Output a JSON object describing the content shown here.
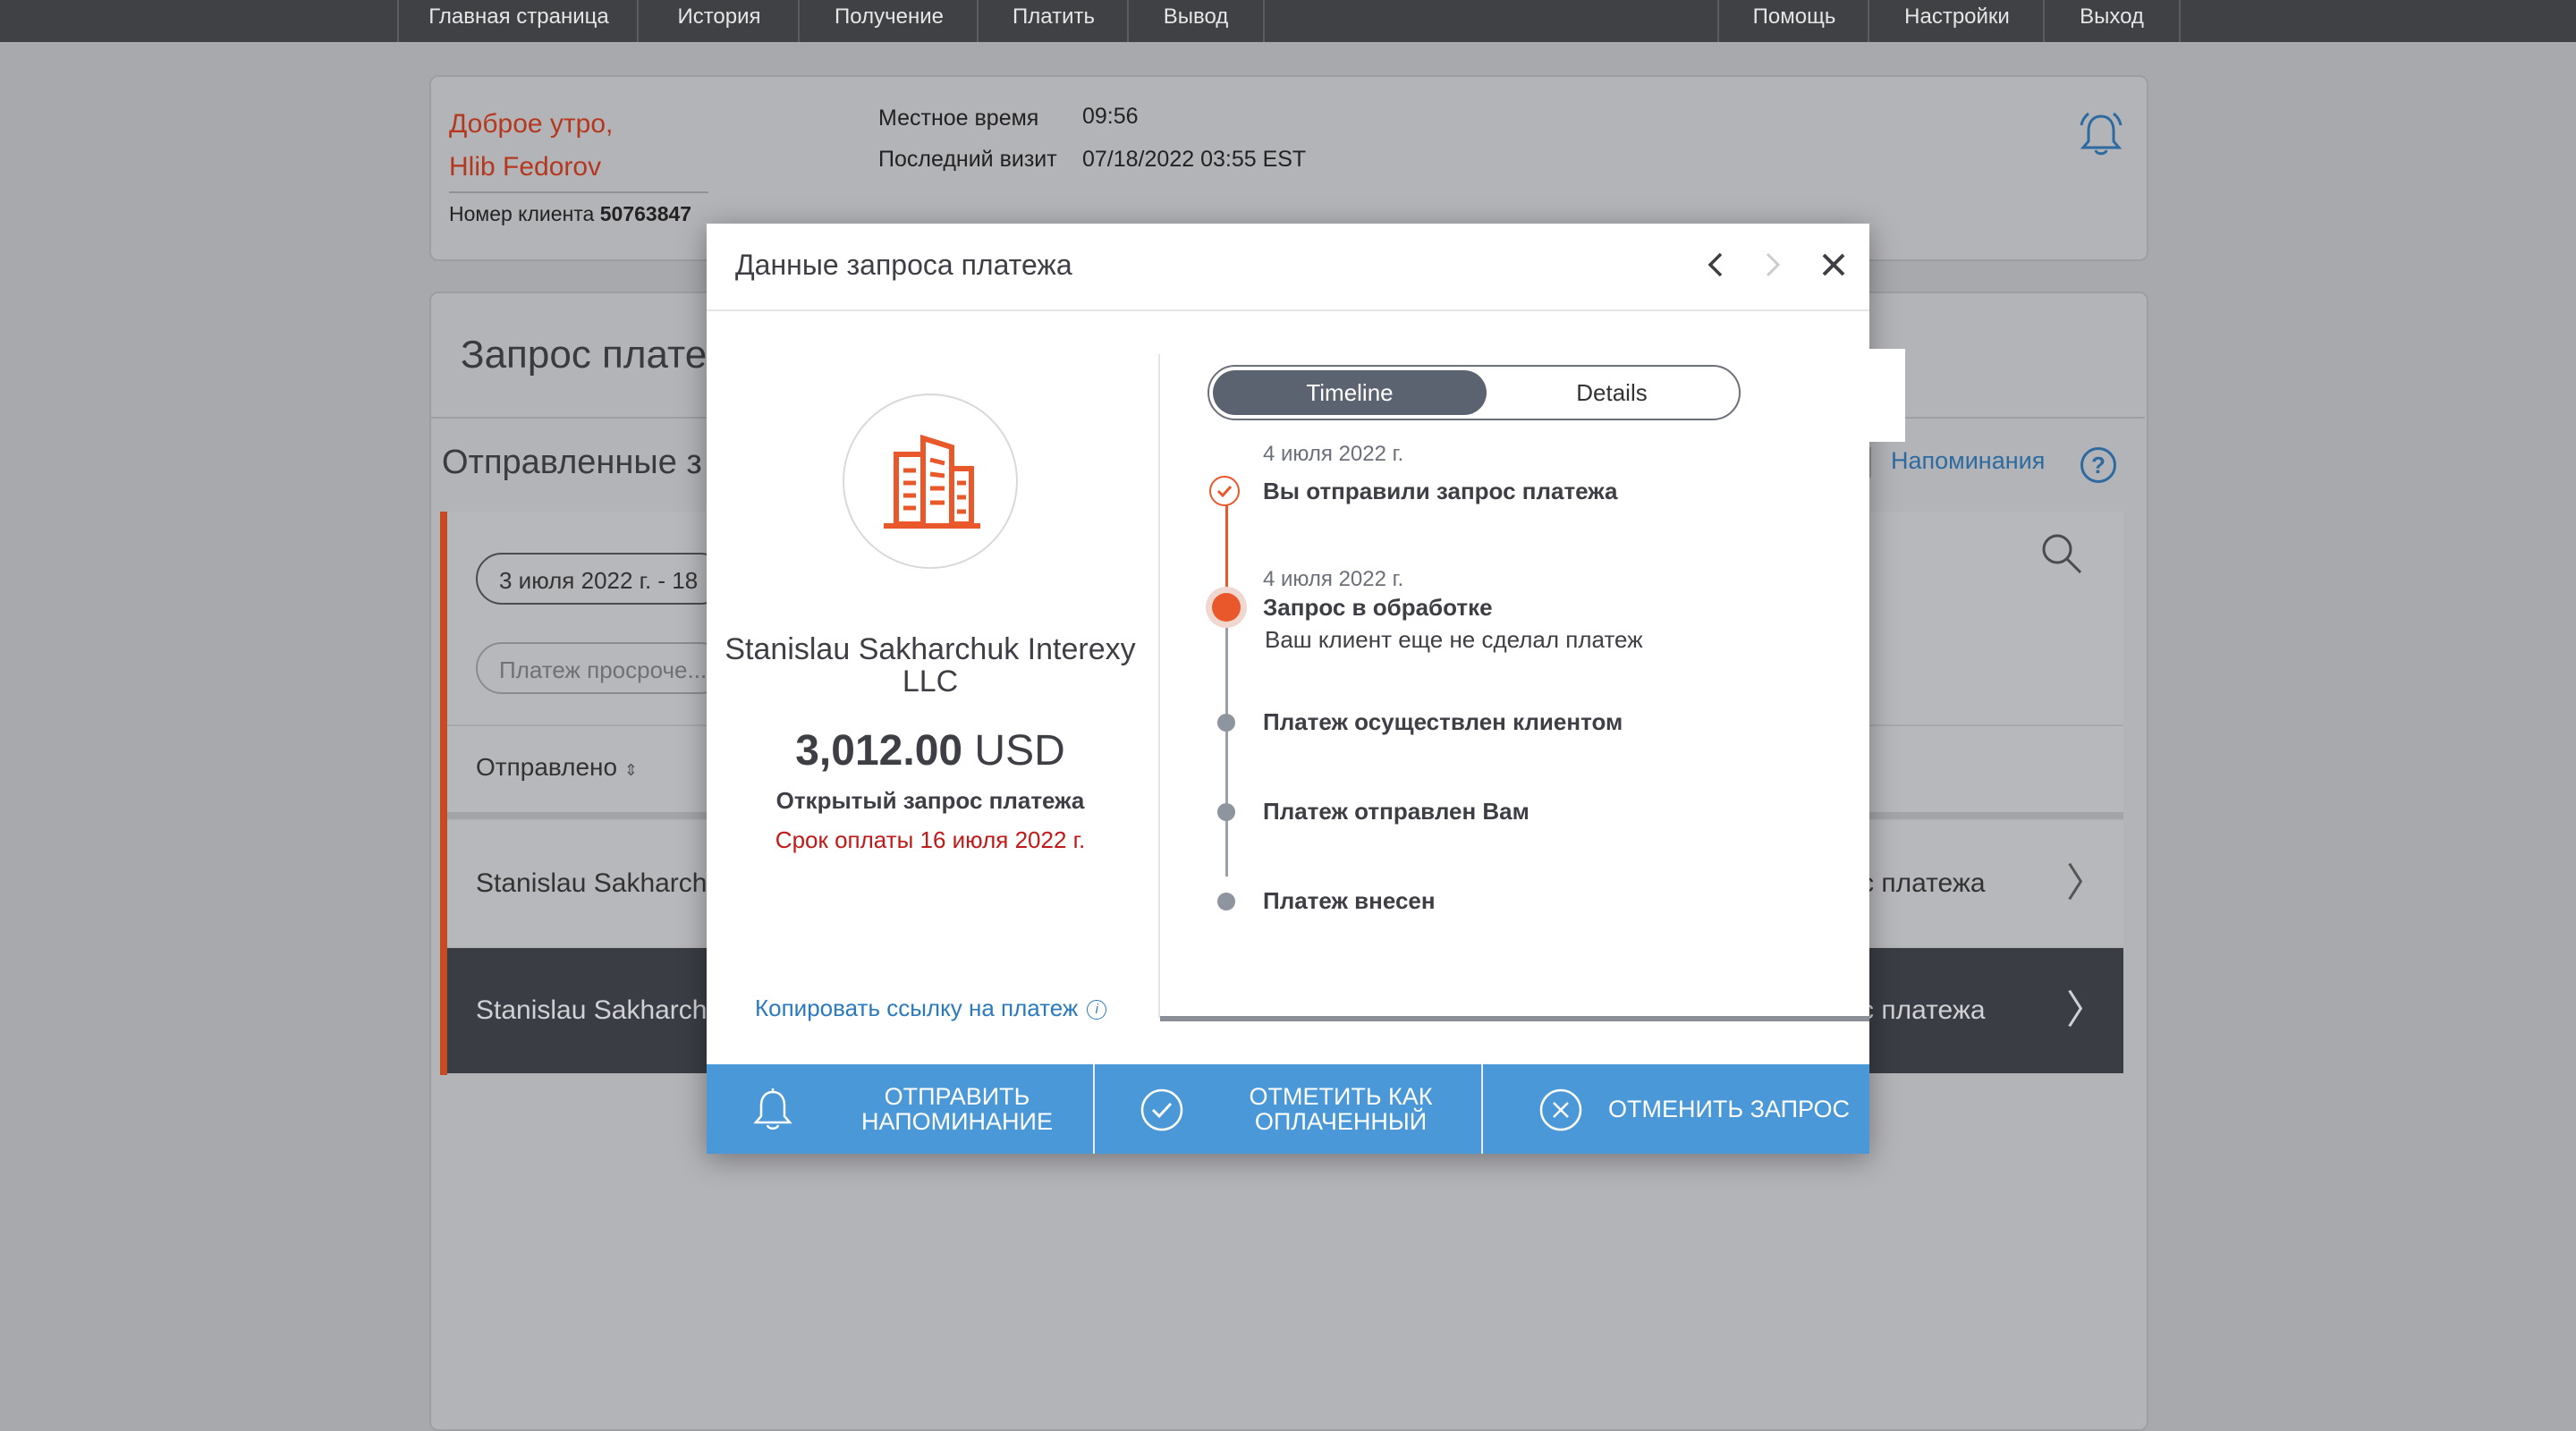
{
  "nav": {
    "left": [
      "Главная страница",
      "История",
      "Получение",
      "Платить",
      "Вывод"
    ],
    "right": [
      "Помощь",
      "Настройки",
      "Выход"
    ]
  },
  "header": {
    "greeting_line1": "Доброе утро,",
    "greeting_line2": "Hlib Fedorov",
    "client_label": "Номер клиента",
    "client_number": "50763847",
    "local_time_label": "Местное время",
    "local_time_value": "09:56",
    "last_visit_label": "Последний визит",
    "last_visit_value": "07/18/2022 03:55 EST"
  },
  "background_panel": {
    "title": "Запрос плате",
    "subtitle": "Отправленные з",
    "reminders_link": "Напоминания",
    "help": "?",
    "date_filter": "3 июля 2022 г. - 18",
    "status_filter_placeholder": "Платеж просроче...",
    "sort_label": "Отправлено",
    "rows": [
      {
        "left": "Stanislau Sakharchu",
        "right": "с платежа"
      },
      {
        "left": "Stanislau Sakharchu",
        "right": "с платежа"
      }
    ]
  },
  "modal": {
    "title": "Данные запроса платежа",
    "company": "Stanislau Sakharchuk Interexy LLC",
    "amount": "3,012.00",
    "currency": "USD",
    "status": "Открытый запрос платежа",
    "due": "Срок оплаты 16 июля 2022 г.",
    "copy_link": "Копировать ссылку на платеж",
    "tabs": {
      "active": "Timeline",
      "inactive": "Details"
    },
    "timeline": [
      {
        "date": "4 июля 2022 г.",
        "title": "Вы отправили запрос платежа",
        "desc": "",
        "state": "done"
      },
      {
        "date": "4 июля 2022 г.",
        "title": "Запрос в обработке",
        "desc": "Ваш клиент еще не сделал платеж",
        "state": "active"
      },
      {
        "date": "",
        "title": "Платеж осуществлен клиентом",
        "desc": "",
        "state": "pending"
      },
      {
        "date": "",
        "title": "Платеж отправлен Вам",
        "desc": "",
        "state": "pending"
      },
      {
        "date": "",
        "title": "Платеж внесен",
        "desc": "",
        "state": "pending"
      }
    ],
    "footer": {
      "send_reminder_l1": "ОТПРАВИТЬ",
      "send_reminder_l2": "НАПОМИНАНИЕ",
      "mark_paid_l1": "ОТМЕТИТЬ КАК",
      "mark_paid_l2": "ОПЛАЧЕННЫЙ",
      "cancel": "ОТМЕНИТЬ ЗАПРОС"
    }
  },
  "colors": {
    "accent_orange": "#e8582b",
    "footer_blue": "#4a98d7",
    "link_blue": "#2a7abf",
    "due_red": "#c11818",
    "nav_bg": "#3f4144"
  }
}
